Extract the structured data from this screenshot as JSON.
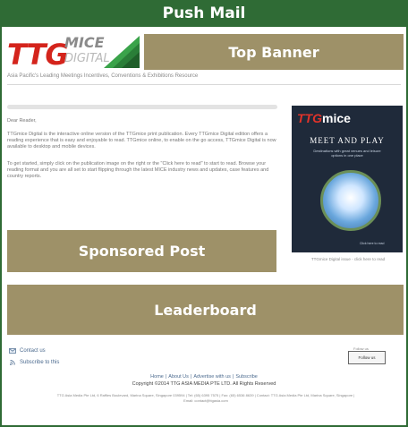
{
  "header": {
    "title": "Push Mail"
  },
  "logo": {
    "ttg": "TTG",
    "mice": "MICE",
    "digital": "DIGITAL"
  },
  "tagline": "Asia Pacific's Leading Meetings Incentives, Conventions & Exhibitions Resource",
  "banners": {
    "top": "Top Banner",
    "sponsored": "Sponsored Post",
    "leaderboard": "Leaderboard"
  },
  "letter": {
    "greeting": "Dear Reader,",
    "para1": "TTGmice Digital is the interactive online version of the TTGmice print publication. Every TTGmice Digital edition offers a reading experience that is easy and enjoyable to read. TTGmice online, to enable on the go access, TTGmice Digital is now available to desktop and mobile devices.",
    "para2": "To get started, simply click on the publication image on the right or the \"Click here to read\" to start to read. Browse your reading format and you are all set to start flipping through the latest MICE industry news and updates, case features and country reports."
  },
  "cover": {
    "ttg": "TTG",
    "mice": "mice",
    "title": "MEET AND PLAY",
    "subtitle": "Destinations with great venues and leisure options in one place",
    "tag": "Click here to read",
    "caption": "TTGmice Digital issue - click here to read"
  },
  "contact": {
    "contact_us": "Contact us",
    "subscribe": "Subscribe to this"
  },
  "follow": {
    "label": "Follow us",
    "button": "Follow us"
  },
  "footer": {
    "links": [
      "Home",
      "About Us",
      "Advertise with us",
      "Subscribe"
    ],
    "copyright": "Copyright ©2014 TTG ASIA MEDIA PTE LTD. All Rights Reserved",
    "address": "TTG Asia Media Pte Ltd, 6 Raffles Boulevard, Marina Square, Singapore 039594 | Tel: (65) 6395 7575 | Fax: (65) 6536 8639 | Contact: TTG Asia Media Pte Ltd, Marina Square, Singapore | Email: contact@ttgasia.com"
  },
  "colors": {
    "header_green": "#2f6b35",
    "banner": "#9e9168"
  }
}
